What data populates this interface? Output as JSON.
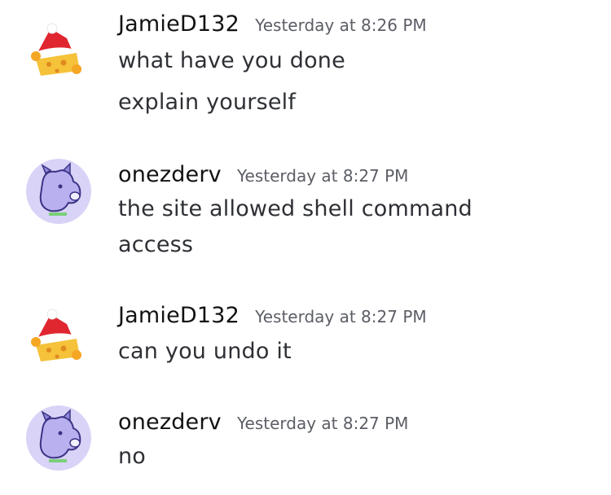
{
  "messages": [
    {
      "author": "JamieD132",
      "timestamp": "Yesterday at 8:26 PM",
      "avatar_icon": "cheese-santa-hat-avatar-icon",
      "lines": [
        "what have you done",
        "explain yourself"
      ]
    },
    {
      "author": "onezderv",
      "timestamp": "Yesterday at 8:27 PM",
      "avatar_icon": "purple-cow-avatar-icon",
      "lines": [
        "the site allowed shell command",
        "access"
      ]
    },
    {
      "author": "JamieD132",
      "timestamp": "Yesterday at 8:27 PM",
      "avatar_icon": "cheese-santa-hat-avatar-icon",
      "lines": [
        "can you undo it"
      ]
    },
    {
      "author": "onezderv",
      "timestamp": "Yesterday at 8:27 PM",
      "avatar_icon": "purple-cow-avatar-icon",
      "lines": [
        "no"
      ]
    }
  ],
  "colors": {
    "username": "#111214",
    "timestamp": "#5c5e66",
    "message_text": "#2e3035",
    "cow_avatar_bg": "#d9d3f7",
    "cheese": "#f5c23a",
    "santa_hat": "#e0262f"
  }
}
